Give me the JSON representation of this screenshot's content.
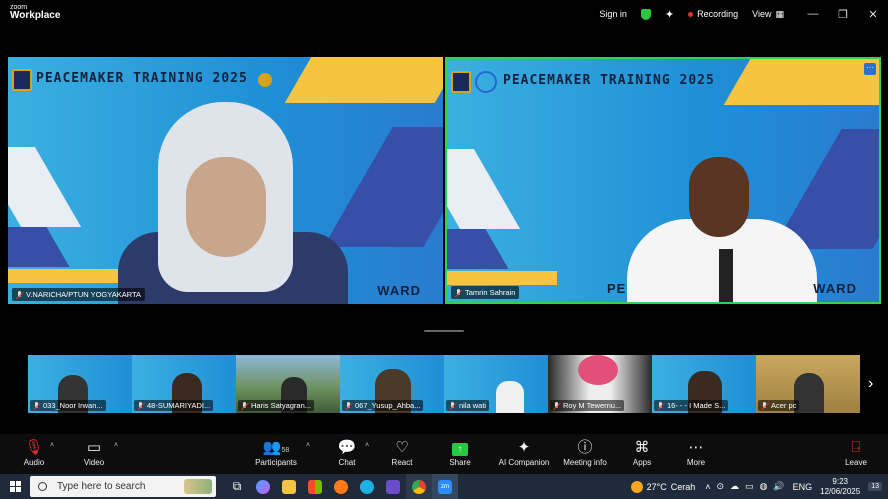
{
  "app": {
    "brand_small": "zoom",
    "brand_large": "Workplace"
  },
  "titlebar": {
    "signin": "Sign in",
    "recording": "Recording",
    "view": "View"
  },
  "main_tiles": [
    {
      "banner": "PEACEMAKER TRAINING 2025",
      "name": "V.NARICHA/PTUN YOGYAKARTA",
      "corner_text": "WARD"
    },
    {
      "banner": "PEACEMAKER TRAINING 2025",
      "name": "Tamrin Sahrain",
      "corner_text": "WARD",
      "prefix_text": "PE"
    }
  ],
  "thumbnails": [
    {
      "name": "033_Noor Irwan..."
    },
    {
      "name": "48-SUMARIYADI..."
    },
    {
      "name": "Haris Satyagran..."
    },
    {
      "name": "067_Yusup_Ahba..."
    },
    {
      "name": "nila wati"
    },
    {
      "name": "Roy M Tewernu..."
    },
    {
      "name": "16- - - I Made S..."
    },
    {
      "name": "Acer pc"
    }
  ],
  "toolbar": {
    "audio": "Audio",
    "video": "Video",
    "participants": "Participants",
    "participant_count": "58",
    "chat": "Chat",
    "react": "React",
    "share": "Share",
    "ai_companion": "AI Companion",
    "meeting_info": "Meeting info",
    "apps": "Apps",
    "more": "More",
    "leave": "Leave"
  },
  "taskbar": {
    "search_placeholder": "Type here to search",
    "weather_temp": "27°C",
    "weather_desc": "Cerah",
    "language": "ENG",
    "time": "9:23",
    "date": "12/06/2025",
    "notification_count": "13"
  },
  "colors": {
    "active_speaker": "#2fd158",
    "share_green": "#27c93f",
    "leave_red": "#e02f2f",
    "record_red": "#e02f2f"
  }
}
